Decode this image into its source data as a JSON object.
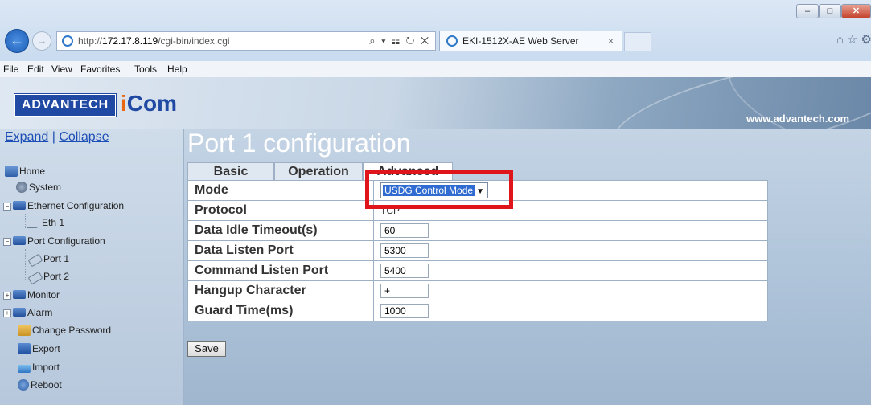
{
  "browser": {
    "url_prefix": "http://",
    "url_host": "172.17.8.119",
    "url_path": "/cgi-bin/index.cgi",
    "address_tools": "⌕ ▾ ☷ ↻ ✕",
    "tab_title": "EKI-1512X-AE Web Server",
    "tab_close": "×",
    "window_min": "–",
    "window_max": "□",
    "window_close": "✕",
    "chrome_icons": "⌂☆⚙"
  },
  "menubar": [
    "File",
    "Edit",
    "View",
    "Favorites",
    "Tools",
    "Help"
  ],
  "header": {
    "logo_advantech": "ADVANTECH",
    "logo_icom_i": "i",
    "logo_icom_rest": "Com",
    "url": "www.advantech.com"
  },
  "sidebar": {
    "expand": "Expand",
    "separator": "|",
    "collapse": "Collapse",
    "items": {
      "home": "Home",
      "system": "System",
      "ethernet_config": "Ethernet Configuration",
      "eth1": "Eth 1",
      "port_config": "Port Configuration",
      "port1": "Port 1",
      "port2": "Port 2",
      "monitor": "Monitor",
      "alarm": "Alarm",
      "change_password": "Change Password",
      "export": "Export",
      "import": "Import",
      "reboot": "Reboot"
    }
  },
  "main": {
    "title": "Port 1 configuration",
    "tabs": [
      "Basic",
      "Operation",
      "Advanced"
    ],
    "rows": {
      "mode_label": "Mode",
      "mode_value": "USDG Control Mode",
      "protocol_label": "Protocol",
      "protocol_value": "TCP",
      "idle_label": "Data Idle Timeout(s)",
      "idle_value": "60",
      "data_port_label": "Data Listen Port",
      "data_port_value": "5300",
      "cmd_port_label": "Command Listen Port",
      "cmd_port_value": "5400",
      "hangup_label": "Hangup Character",
      "hangup_value": "+",
      "guard_label": "Guard Time(ms)",
      "guard_value": "1000"
    },
    "save_label": "Save"
  },
  "colors": {
    "highlight": "#e0141b",
    "brand_blue": "#1f49a3",
    "brand_orange": "#e9680f",
    "link": "#1c4fb5"
  }
}
